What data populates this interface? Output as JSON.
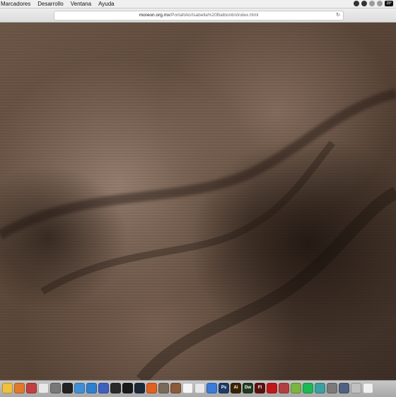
{
  "menubar": {
    "items": [
      "Marcadores",
      "Desarrollo",
      "Ventana",
      "Ayuda"
    ],
    "badge": "28°"
  },
  "browser": {
    "url_host": "moreon.org.mx",
    "url_path": "/Portafolio/Isabella%20Balbontin/index.html"
  },
  "page": {
    "background_image": "close-up-brown-knit-fabric"
  },
  "dock": {
    "apps": [
      {
        "icon": "finder-icon",
        "color": "#f0c040",
        "glyph": ""
      },
      {
        "icon": "launchpad-icon",
        "color": "#e07a2a",
        "glyph": ""
      },
      {
        "icon": "photo-icon",
        "color": "#c04040",
        "glyph": ""
      },
      {
        "icon": "document-icon",
        "color": "#e8e8e8",
        "glyph": ""
      },
      {
        "icon": "settings-icon",
        "color": "#777777",
        "glyph": ""
      },
      {
        "icon": "terminal-icon",
        "color": "#222222",
        "glyph": ""
      },
      {
        "icon": "folder-icon",
        "color": "#3f8fd6",
        "glyph": ""
      },
      {
        "icon": "folder-icon",
        "color": "#2f7fcf",
        "glyph": ""
      },
      {
        "icon": "app-icon",
        "color": "#4060c0",
        "glyph": ""
      },
      {
        "icon": "app-icon",
        "color": "#2a2a2a",
        "glyph": ""
      },
      {
        "icon": "console-icon",
        "color": "#1a1a1a",
        "glyph": ""
      },
      {
        "icon": "steam-icon",
        "color": "#1b2838",
        "glyph": ""
      },
      {
        "icon": "app-icon",
        "color": "#e06020",
        "glyph": ""
      },
      {
        "icon": "app-icon",
        "color": "#7a6a5a",
        "glyph": ""
      },
      {
        "icon": "app-icon",
        "color": "#8a5a3a",
        "glyph": ""
      },
      {
        "icon": "document-icon",
        "color": "#f5f5f5",
        "glyph": ""
      },
      {
        "icon": "chart-icon",
        "color": "#e8e8e8",
        "glyph": ""
      },
      {
        "icon": "keynote-icon",
        "color": "#3a7ad8",
        "glyph": ""
      },
      {
        "icon": "photoshop-icon",
        "color": "#1f3a63",
        "glyph": "Ps"
      },
      {
        "icon": "illustrator-icon",
        "color": "#3a2200",
        "glyph": "Ai"
      },
      {
        "icon": "dreamweaver-icon",
        "color": "#1f3a20",
        "glyph": "Dw"
      },
      {
        "icon": "flash-icon",
        "color": "#5a1010",
        "glyph": "Fl"
      },
      {
        "icon": "filezilla-icon",
        "color": "#c01818",
        "glyph": ""
      },
      {
        "icon": "app-icon",
        "color": "#b04040",
        "glyph": ""
      },
      {
        "icon": "android-icon",
        "color": "#7cb342",
        "glyph": ""
      },
      {
        "icon": "spotify-icon",
        "color": "#1db954",
        "glyph": ""
      },
      {
        "icon": "app-icon",
        "color": "#3aa0a0",
        "glyph": ""
      },
      {
        "icon": "app-icon",
        "color": "#7a7a7a",
        "glyph": ""
      },
      {
        "icon": "app-icon",
        "color": "#506080",
        "glyph": ""
      },
      {
        "icon": "app-icon",
        "color": "#c0c0c0",
        "glyph": ""
      },
      {
        "icon": "document-icon",
        "color": "#f0f0f0",
        "glyph": ""
      }
    ]
  }
}
